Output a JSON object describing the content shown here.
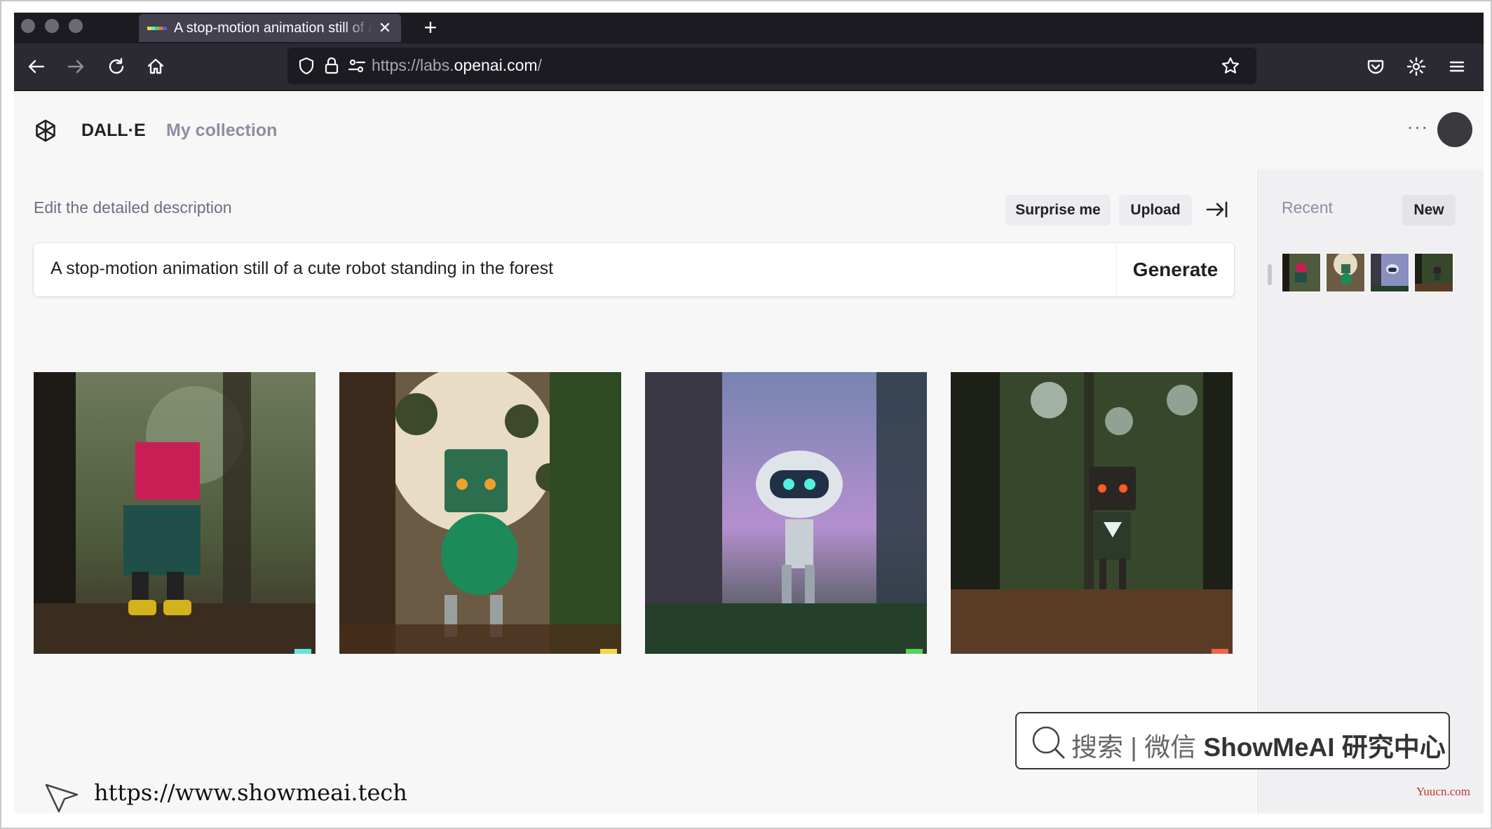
{
  "browser": {
    "tab_title": "A stop-motion animation still of a cute robot standing in the forest",
    "tab_close_icon": "close-icon",
    "new_tab_label": "+",
    "url_protocol": "https://labs.",
    "url_domain": "openai.com",
    "url_path": "/",
    "icons": [
      "back-arrow-icon",
      "forward-arrow-icon",
      "reload-icon",
      "home-icon",
      "shield-icon",
      "lock-icon",
      "permissions-icon",
      "star-icon",
      "pocket-icon",
      "settings-gear-icon",
      "hamburger-menu-icon"
    ]
  },
  "header": {
    "brand": "DALL·E",
    "nav_collection": "My collection",
    "more_label": "···"
  },
  "editor": {
    "label": "Edit the detailed description",
    "surprise_label": "Surprise me",
    "upload_label": "Upload",
    "prompt_text": "A stop-motion animation still of a cute robot standing in the forest",
    "generate_label": "Generate"
  },
  "results": {
    "images": [
      {
        "subject": "pink-headed block robot in forest"
      },
      {
        "subject": "green robot with orange eyes"
      },
      {
        "subject": "white robot with teal visor"
      },
      {
        "subject": "dark robot with red eyes"
      }
    ]
  },
  "sidebar": {
    "recent_label": "Recent",
    "new_label": "New"
  },
  "watermark": {
    "search_label": "搜索",
    "divider": "|",
    "wechat_label": "微信",
    "brand_label": "ShowMeAI 研究中心",
    "site_url": "https://www.showmeai.tech",
    "corner_text": "Yuucn.com"
  },
  "colors": {
    "chrome_dark": "#1c1b22",
    "toolbar": "#2b2a33",
    "app_bg": "#f7f7f8",
    "sidebar_bg": "#f0f0f3",
    "text_primary": "#202123",
    "text_muted": "#8e8ea0"
  }
}
